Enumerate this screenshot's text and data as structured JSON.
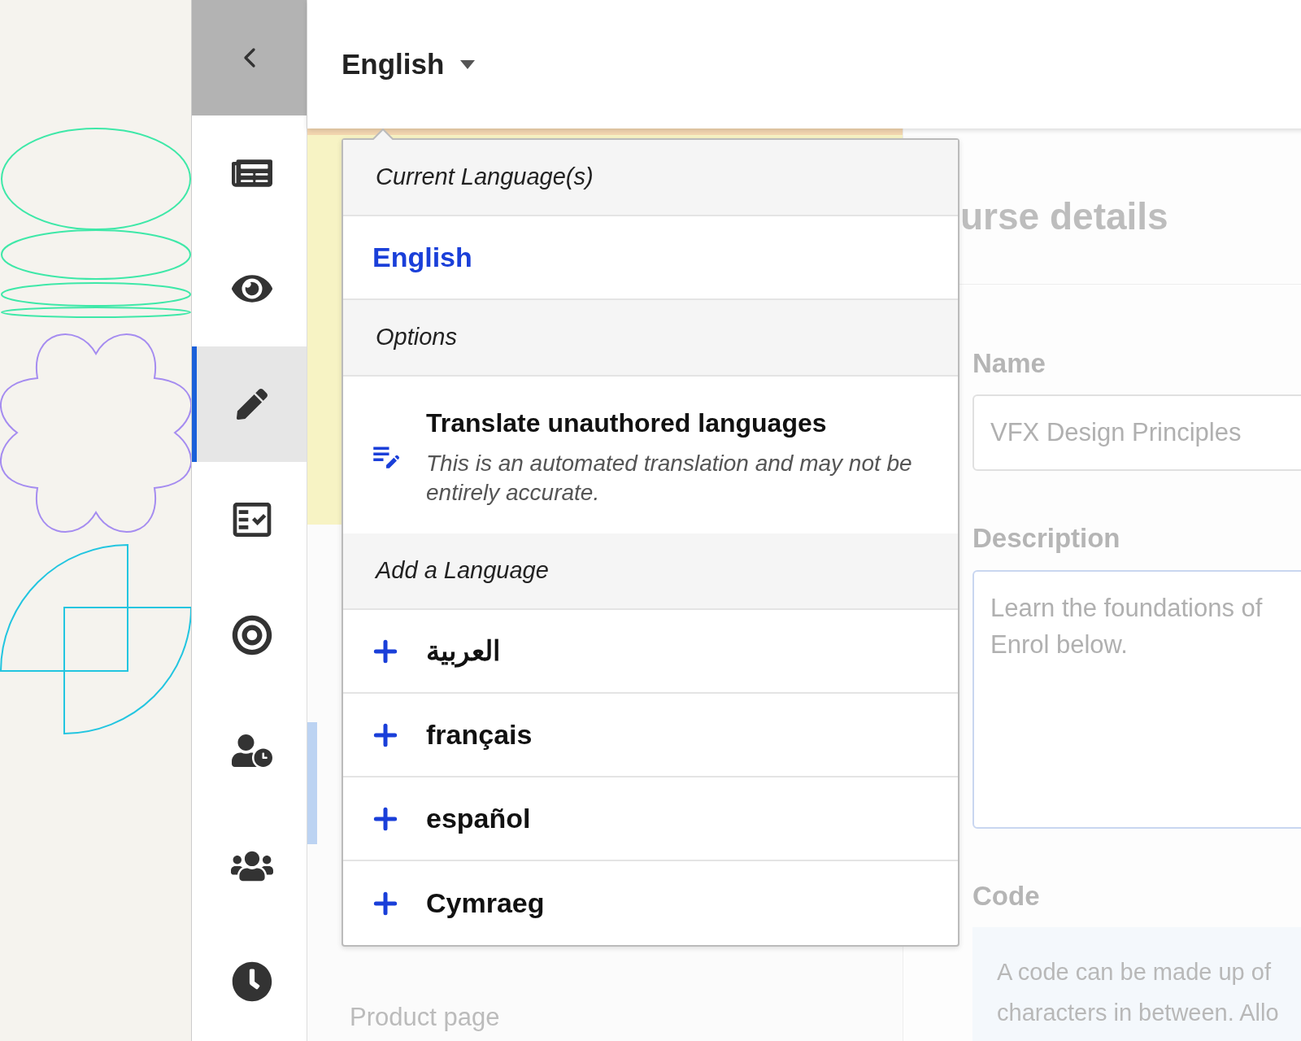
{
  "sidebar": {
    "items": [
      {
        "kind": "overview",
        "selected": false
      },
      {
        "kind": "preview",
        "selected": false
      },
      {
        "kind": "edit",
        "selected": true
      },
      {
        "kind": "review",
        "selected": false
      },
      {
        "kind": "goals",
        "selected": false
      },
      {
        "kind": "schedule",
        "selected": false
      },
      {
        "kind": "groups",
        "selected": false
      },
      {
        "kind": "history",
        "selected": false
      }
    ]
  },
  "language_button": {
    "label": "English"
  },
  "language_menu": {
    "current_header": "Current Language(s)",
    "current": [
      {
        "label": "English",
        "selected": true
      }
    ],
    "options_header": "Options",
    "option": {
      "title": "Translate unauthored languages",
      "description": "This is an automated translation and may not be entirely accurate."
    },
    "add_header": "Add a Language",
    "add_languages": [
      {
        "label": "العربية"
      },
      {
        "label": "français"
      },
      {
        "label": "español"
      },
      {
        "label": "Cymraeg"
      }
    ]
  },
  "page": {
    "title": "urse details",
    "name_label": "Name",
    "name_value": "VFX Design Principles",
    "description_label": "Description",
    "description_lines": [
      "Learn the foundations of",
      "Enrol below."
    ],
    "code_label": "Code",
    "code_lines": [
      "A code can be made up of",
      "characters in between. Allo"
    ],
    "product_page": "Product page"
  }
}
